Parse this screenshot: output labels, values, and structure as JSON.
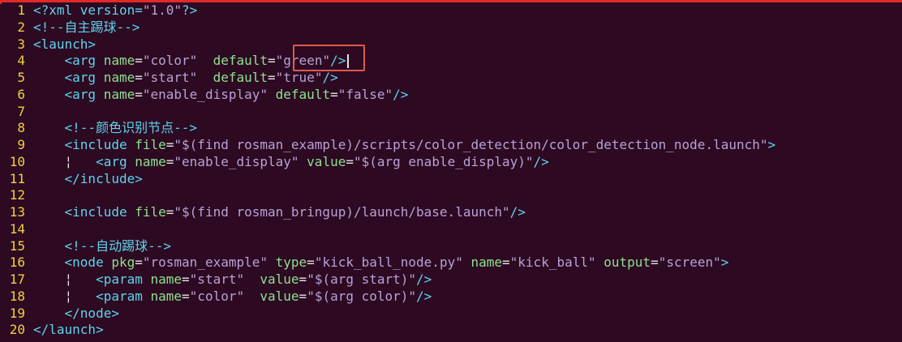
{
  "editor": {
    "lines": [
      {
        "n": "1",
        "tokens": [
          [
            "decl",
            "<?xml version="
          ],
          [
            "str",
            "\"1.0\""
          ],
          [
            "decl",
            "?>"
          ]
        ]
      },
      {
        "n": "2",
        "tokens": [
          [
            "cmt",
            "<!--自主踢球-->"
          ]
        ]
      },
      {
        "n": "3",
        "tokens": [
          [
            "tag",
            "<launch>"
          ]
        ]
      },
      {
        "n": "4",
        "tokens": [
          [
            "tag",
            "    <arg "
          ],
          [
            "attr",
            "name"
          ],
          [
            "eq",
            "="
          ],
          [
            "str",
            "\"color\""
          ],
          [
            "tag",
            "  "
          ],
          [
            "attr",
            "default"
          ],
          [
            "eq",
            "="
          ],
          [
            "str",
            "\"green\""
          ],
          [
            "tag",
            "/>"
          ]
        ]
      },
      {
        "n": "5",
        "tokens": [
          [
            "tag",
            "    <arg "
          ],
          [
            "attr",
            "name"
          ],
          [
            "eq",
            "="
          ],
          [
            "str",
            "\"start\""
          ],
          [
            "tag",
            "  "
          ],
          [
            "attr",
            "default"
          ],
          [
            "eq",
            "="
          ],
          [
            "str",
            "\"true\""
          ],
          [
            "tag",
            "/>"
          ]
        ]
      },
      {
        "n": "6",
        "tokens": [
          [
            "tag",
            "    <arg "
          ],
          [
            "attr",
            "name"
          ],
          [
            "eq",
            "="
          ],
          [
            "str",
            "\"enable_display\""
          ],
          [
            "tag",
            " "
          ],
          [
            "attr",
            "default"
          ],
          [
            "eq",
            "="
          ],
          [
            "str",
            "\"false\""
          ],
          [
            "tag",
            "/>"
          ]
        ]
      },
      {
        "n": "7",
        "tokens": []
      },
      {
        "n": "8",
        "tokens": [
          [
            "cmt",
            "    <!--颜色识别节点-->"
          ]
        ]
      },
      {
        "n": "9",
        "tokens": [
          [
            "tag",
            "    <include "
          ],
          [
            "attr",
            "file"
          ],
          [
            "eq",
            "="
          ],
          [
            "str",
            "\"$(find rosman_example)/scripts/color_detection/color_detection_node.launch\""
          ],
          [
            "tag",
            ">"
          ]
        ]
      },
      {
        "n": "10",
        "tokens": [
          [
            "guide",
            "    ¦   "
          ],
          [
            "tag",
            "<arg "
          ],
          [
            "attr",
            "name"
          ],
          [
            "eq",
            "="
          ],
          [
            "str",
            "\"enable_display\""
          ],
          [
            "tag",
            " "
          ],
          [
            "attr",
            "value"
          ],
          [
            "eq",
            "="
          ],
          [
            "str",
            "\"$(arg enable_display)\""
          ],
          [
            "tag",
            "/>"
          ]
        ]
      },
      {
        "n": "11",
        "tokens": [
          [
            "tag",
            "    </include>"
          ]
        ]
      },
      {
        "n": "12",
        "tokens": []
      },
      {
        "n": "13",
        "tokens": [
          [
            "tag",
            "    <include "
          ],
          [
            "attr",
            "file"
          ],
          [
            "eq",
            "="
          ],
          [
            "str",
            "\"$(find rosman_bringup)/launch/base.launch\""
          ],
          [
            "tag",
            "/>"
          ]
        ]
      },
      {
        "n": "14",
        "tokens": []
      },
      {
        "n": "15",
        "tokens": [
          [
            "cmt",
            "    <!--自动踢球-->"
          ]
        ]
      },
      {
        "n": "16",
        "tokens": [
          [
            "tag",
            "    <node "
          ],
          [
            "attr",
            "pkg"
          ],
          [
            "eq",
            "="
          ],
          [
            "str",
            "\"rosman_example\""
          ],
          [
            "tag",
            " "
          ],
          [
            "attr",
            "type"
          ],
          [
            "eq",
            "="
          ],
          [
            "str",
            "\"kick_ball_node.py\""
          ],
          [
            "tag",
            " "
          ],
          [
            "attr",
            "name"
          ],
          [
            "eq",
            "="
          ],
          [
            "str",
            "\"kick_ball\""
          ],
          [
            "tag",
            " "
          ],
          [
            "attr",
            "output"
          ],
          [
            "eq",
            "="
          ],
          [
            "str",
            "\"screen\""
          ],
          [
            "tag",
            ">"
          ]
        ]
      },
      {
        "n": "17",
        "tokens": [
          [
            "guide",
            "    ¦   "
          ],
          [
            "tag",
            "<param "
          ],
          [
            "attr",
            "name"
          ],
          [
            "eq",
            "="
          ],
          [
            "str",
            "\"start\""
          ],
          [
            "tag",
            "  "
          ],
          [
            "attr",
            "value"
          ],
          [
            "eq",
            "="
          ],
          [
            "str",
            "\"$(arg start)\""
          ],
          [
            "tag",
            "/>"
          ]
        ]
      },
      {
        "n": "18",
        "tokens": [
          [
            "guide",
            "    ¦   "
          ],
          [
            "tag",
            "<param "
          ],
          [
            "attr",
            "name"
          ],
          [
            "eq",
            "="
          ],
          [
            "str",
            "\"color\""
          ],
          [
            "tag",
            "  "
          ],
          [
            "attr",
            "value"
          ],
          [
            "eq",
            "="
          ],
          [
            "str",
            "\"$(arg color)\""
          ],
          [
            "tag",
            "/>"
          ]
        ]
      },
      {
        "n": "19",
        "tokens": [
          [
            "tag",
            "    </node>"
          ]
        ]
      },
      {
        "n": "20",
        "tokens": [
          [
            "tag",
            "</launch>"
          ]
        ]
      }
    ]
  },
  "colors": {
    "background": "#2d0922",
    "line_number": "#f2d23a",
    "tag": "#5fd4ec",
    "attribute": "#8ce28c",
    "string": "#b8a2d6",
    "highlight_box": "#e05a4a",
    "top_bar": "#e02a2a"
  }
}
